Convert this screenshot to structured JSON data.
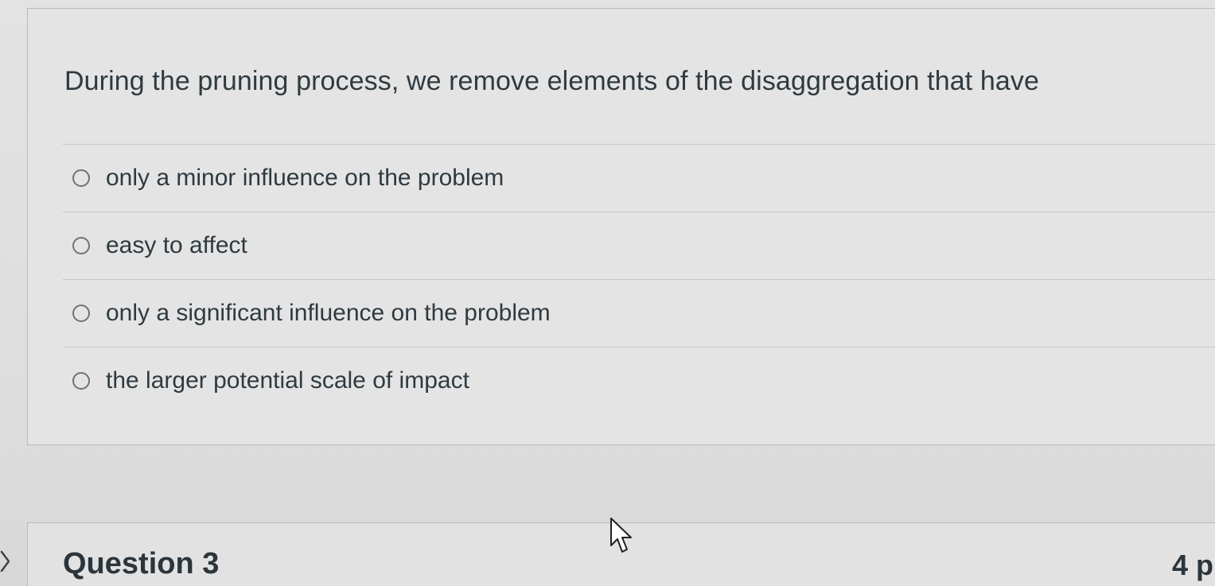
{
  "question": {
    "text": "During the pruning process, we remove elements of the disaggregation that have",
    "answers": [
      {
        "label": "only a minor influence on the problem",
        "selected": false
      },
      {
        "label": "easy to affect",
        "selected": false
      },
      {
        "label": "only a significant influence on the problem",
        "selected": false
      },
      {
        "label": "the larger potential scale of impact",
        "selected": false
      }
    ]
  },
  "next_question": {
    "title": "Question 3",
    "points": "4 p"
  },
  "icons": {
    "radio": "radio-button-icon",
    "chevron": "chevron-right-icon",
    "cursor": "mouse-pointer-icon"
  }
}
